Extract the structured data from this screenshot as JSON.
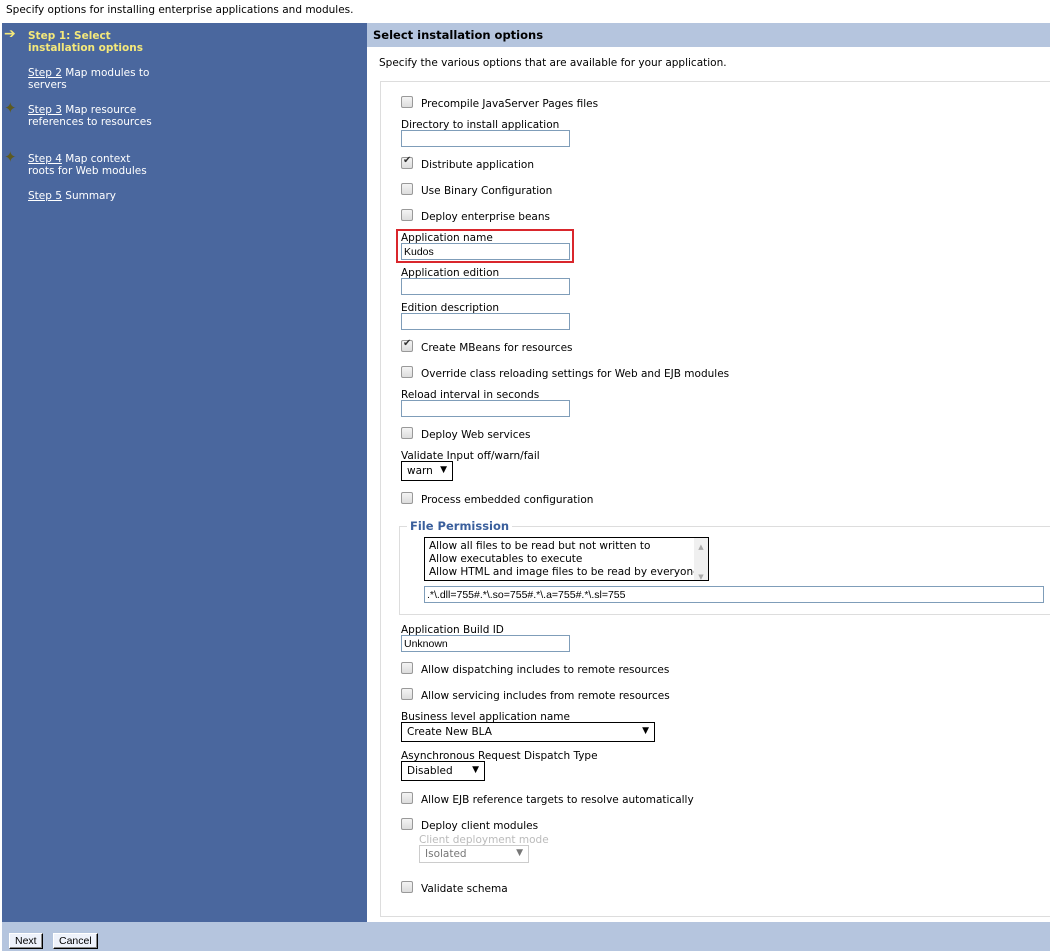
{
  "intro": "Specify options for installing enterprise applications and modules.",
  "steps": [
    {
      "link": "Step 1:",
      "rest": "Select installation options",
      "current": true,
      "icon": "arrow-right-icon"
    },
    {
      "link": "Step 2",
      "rest": "Map modules to servers"
    },
    {
      "link": "Step 3",
      "rest": "Map resource references to resources",
      "icon": "required-diamond-icon"
    },
    {
      "link": "Step 4",
      "rest": "Map context roots for Web modules",
      "icon": "required-diamond-icon"
    },
    {
      "link": "Step 5",
      "rest": "Summary"
    }
  ],
  "header": "Select installation options",
  "description": "Specify the various options that are available for your application.",
  "form": {
    "precompile": "Precompile JavaServer Pages files",
    "directory_label": "Directory to install application",
    "directory_value": "",
    "distribute": "Distribute application",
    "binary": "Use Binary Configuration",
    "deploy_ejb": "Deploy enterprise beans",
    "app_name_label": "Application name",
    "app_name_value": "Kudos",
    "edition_label": "Application edition",
    "edition_value": "",
    "edition_desc_label": "Edition description",
    "edition_desc_value": "",
    "mbeans": "Create MBeans for resources",
    "override": "Override class reloading settings for Web and EJB modules",
    "reload_label": "Reload interval in seconds",
    "reload_value": "",
    "deploy_ws": "Deploy Web services",
    "validate_label": "Validate Input off/warn/fail",
    "validate_value": "warn",
    "process_embedded": "Process embedded configuration",
    "file_permission_legend": "File Permission",
    "file_permission_options": [
      "Allow all files to be read but not written to",
      "Allow executables to execute",
      "Allow HTML and image files to be read by everyone"
    ],
    "file_permission_value": ".*\\.dll=755#.*\\.so=755#.*\\.a=755#.*\\.sl=755",
    "build_id_label": "Application Build ID",
    "build_id_value": "Unknown",
    "dispatching": "Allow dispatching includes to remote resources",
    "servicing": "Allow servicing includes from remote resources",
    "bla_label": "Business level application name",
    "bla_value": "Create New BLA",
    "async_label": "Asynchronous Request Dispatch Type",
    "async_value": "Disabled",
    "ejb_ref": "Allow EJB reference targets to resolve automatically",
    "client_modules": "Deploy client modules",
    "client_mode_label": "Client deployment mode",
    "client_mode_value": "Isolated",
    "validate_schema": "Validate schema"
  },
  "checked": {
    "distribute": true,
    "mbeans": true
  },
  "buttons": {
    "next": "Next",
    "cancel": "Cancel"
  },
  "colors": {
    "sidebar": "#4a679e",
    "header": "#b5c5de",
    "current_step": "#f5e97a",
    "highlight": "#d9262c"
  }
}
